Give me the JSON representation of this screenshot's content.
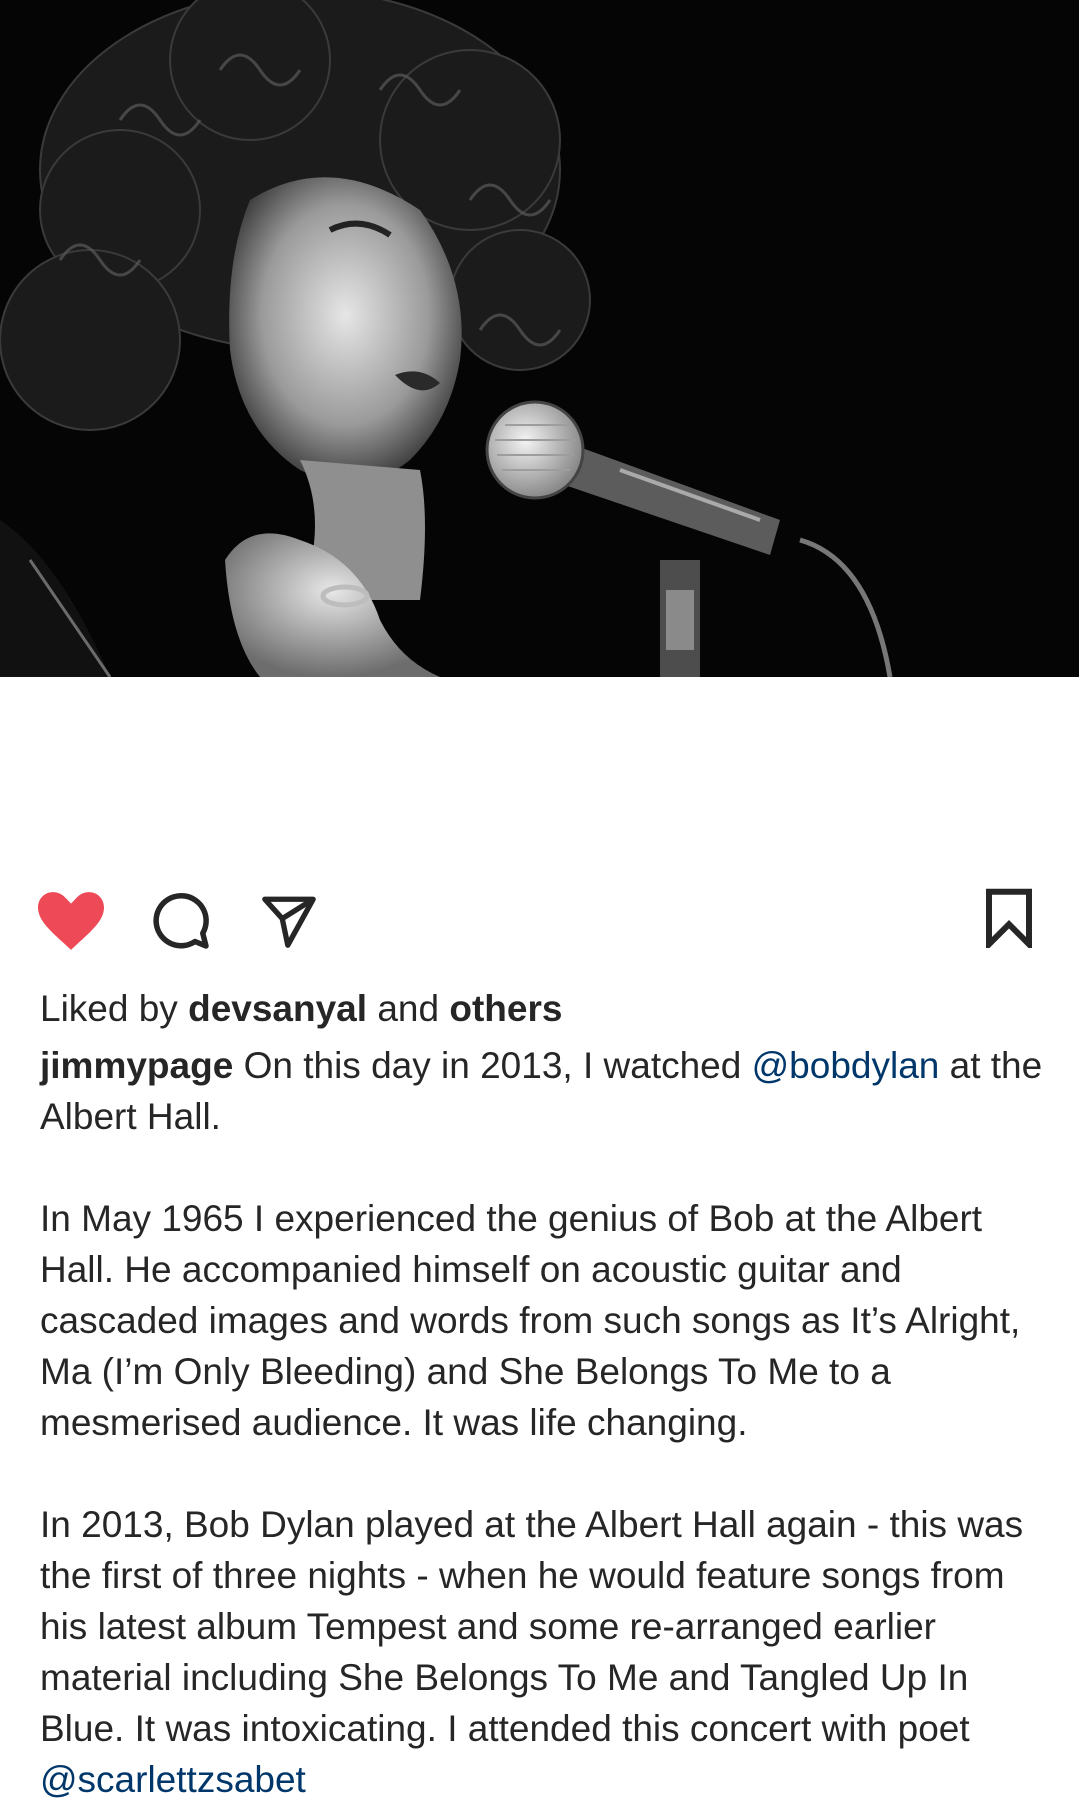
{
  "post": {
    "image_alt": "Black and white photo of a curly-haired singer performing at a microphone",
    "actions": {
      "like_icon": "heart-filled-icon",
      "comment_icon": "comment-icon",
      "share_icon": "send-icon",
      "save_icon": "bookmark-icon",
      "like_color": "#ed4956"
    },
    "likes": {
      "prefix": "Liked by",
      "user": "devsanyal",
      "joiner": "and",
      "others": "others"
    },
    "caption": {
      "username": "jimmypage",
      "line1_a": "On this day in 2013, I watched",
      "mention1": "@bobdylan",
      "line1_b": "at the Albert Hall.",
      "para2": "In May 1965 I experienced the genius of Bob at the Albert Hall. He accompanied himself on acoustic guitar and cascaded images and words from such songs as It’s Alright, Ma (I’m Only Bleeding) and She Belongs To Me to a mesmerised audience. It was life changing.",
      "para3": "In 2013, Bob Dylan played at the Albert Hall again - this was the first of three nights - when he would feature songs from his latest album Tempest and some re-arranged earlier material including She Belongs To Me and Tangled Up In Blue. It was intoxicating. I attended this concert with poet",
      "mention2": "@scarlettzsabet"
    },
    "colors": {
      "text": "#262626",
      "mention": "#00376b",
      "photo_bg": "#050505"
    }
  }
}
